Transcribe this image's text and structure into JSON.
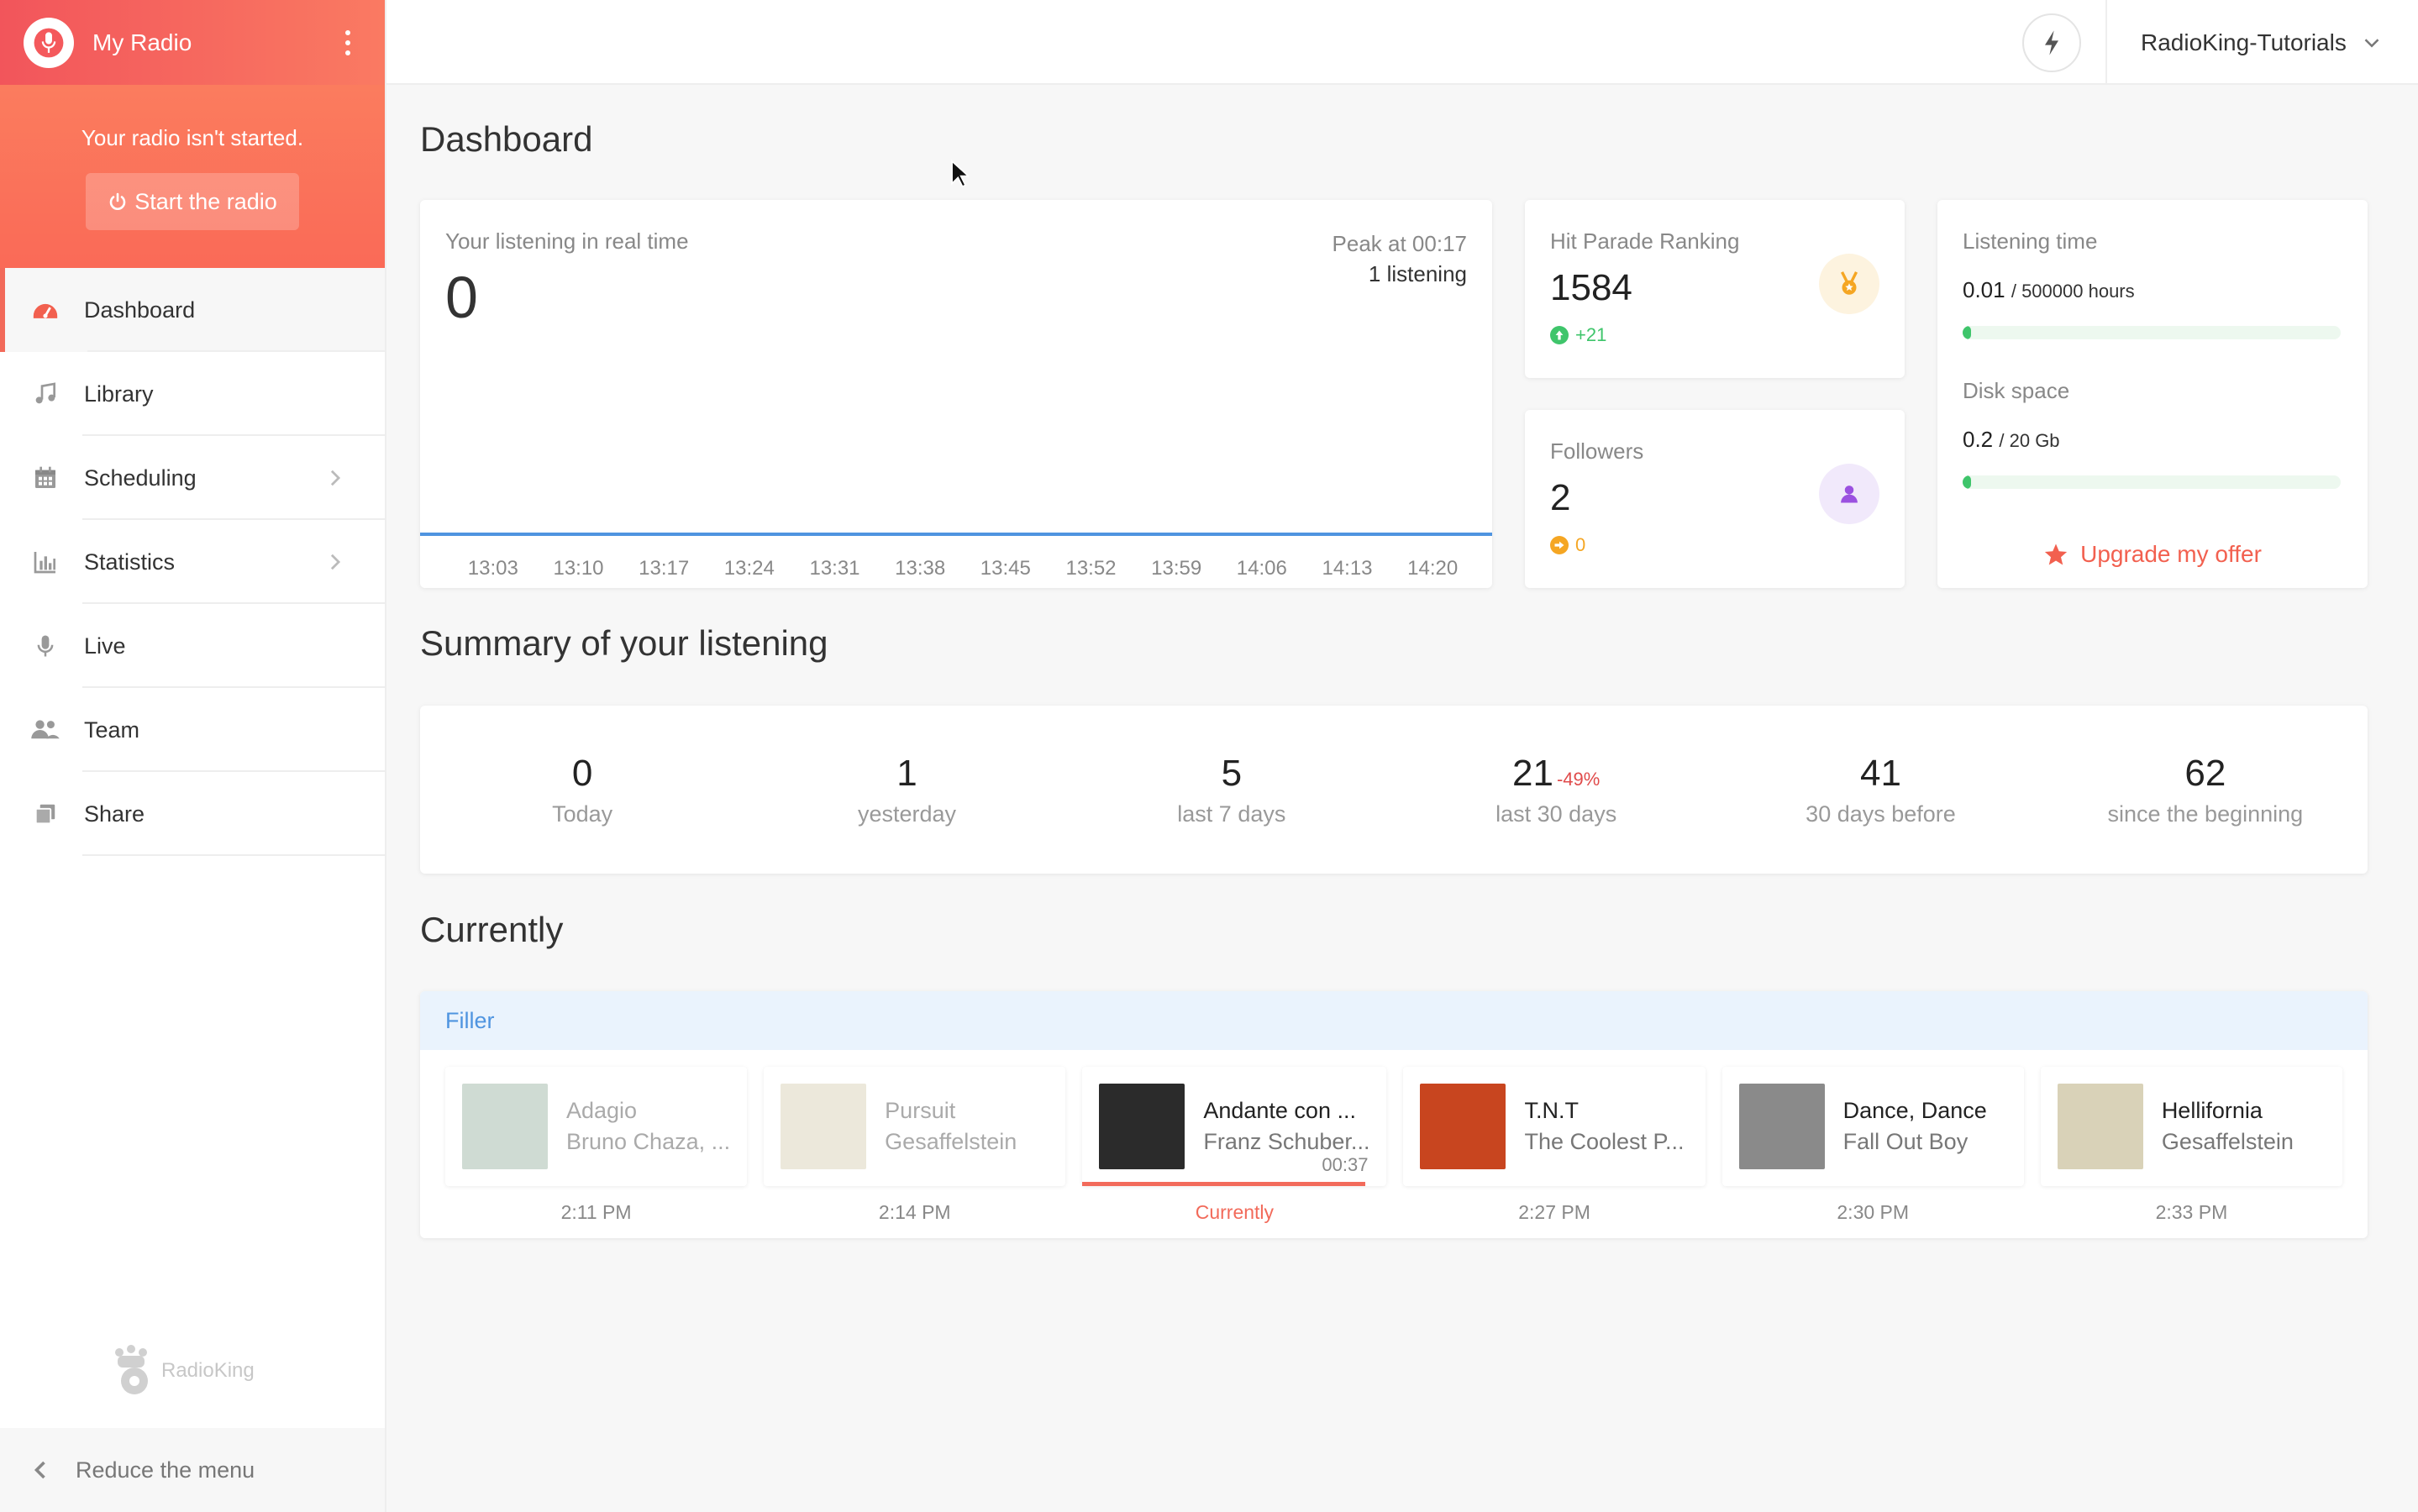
{
  "sidebar": {
    "radio_name": "My Radio",
    "status_text": "Your radio isn't started.",
    "start_label": "Start the radio",
    "items": [
      {
        "label": "Dashboard",
        "icon": "dashboard-icon",
        "active": true
      },
      {
        "label": "Library",
        "icon": "music-note-icon"
      },
      {
        "label": "Scheduling",
        "icon": "calendar-icon",
        "chevron": true
      },
      {
        "label": "Statistics",
        "icon": "bar-chart-icon",
        "chevron": true
      },
      {
        "label": "Live",
        "icon": "microphone-icon"
      },
      {
        "label": "Team",
        "icon": "users-icon"
      },
      {
        "label": "Share",
        "icon": "share-icon"
      }
    ],
    "logo_text": "RadioKing",
    "reduce_label": "Reduce the menu"
  },
  "topbar": {
    "account_name": "RadioKing-Tutorials"
  },
  "page": {
    "title": "Dashboard"
  },
  "realtime": {
    "label": "Your listening in real time",
    "value": "0",
    "peak_label": "Peak at 00:17",
    "peak_listening": "1 listening"
  },
  "chart_data": {
    "type": "line",
    "x": [
      "13:03",
      "13:10",
      "13:17",
      "13:24",
      "13:31",
      "13:38",
      "13:45",
      "13:52",
      "13:59",
      "14:06",
      "14:13",
      "14:20"
    ],
    "series": [
      {
        "values": [
          0,
          0,
          0,
          0,
          0,
          0,
          0,
          0,
          0,
          0,
          0,
          0
        ]
      }
    ],
    "title": "",
    "xlabel": "",
    "ylabel": "",
    "grid": false
  },
  "hit_parade": {
    "label": "Hit Parade Ranking",
    "value": "1584",
    "delta": "+21",
    "delta_color": "#3fc56b"
  },
  "followers": {
    "label": "Followers",
    "value": "2",
    "delta": "0",
    "delta_color": "#f5a623"
  },
  "usage": {
    "listening_label": "Listening time",
    "listening_value": "0.01",
    "listening_total": "/ 500000 hours",
    "listening_fraction": 2e-08,
    "disk_label": "Disk space",
    "disk_value": "0.2",
    "disk_total": "/ 20 Gb",
    "disk_fraction": 0.01,
    "upgrade_label": "Upgrade my offer"
  },
  "summary": {
    "title": "Summary of your listening",
    "cells": [
      {
        "value": "0",
        "label": "Today",
        "pct": ""
      },
      {
        "value": "1",
        "label": "yesterday",
        "pct": ""
      },
      {
        "value": "5",
        "label": "last 7 days",
        "pct": ""
      },
      {
        "value": "21",
        "label": "last 30 days",
        "pct": "-49%"
      },
      {
        "value": "41",
        "label": "30 days before",
        "pct": ""
      },
      {
        "value": "62",
        "label": "since the beginning",
        "pct": ""
      }
    ]
  },
  "currently": {
    "title": "Currently",
    "playlist": "Filler",
    "tracks": [
      {
        "title": "Adagio",
        "artist": "Bruno Chaza, ...",
        "time": "2:11 PM",
        "state": "past",
        "cover": "#9fb7a8"
      },
      {
        "title": "Pursuit",
        "artist": "Gesaffelstein",
        "time": "2:14 PM",
        "state": "past",
        "cover": "#d9d2b8"
      },
      {
        "title": "Andante con ...",
        "artist": "Franz Schuber...",
        "time": "Currently",
        "elapsed": "00:37",
        "progress": 0.93,
        "state": "current",
        "cover": "#2b2b2b"
      },
      {
        "title": "T.N.T",
        "artist": "The Coolest P...",
        "time": "2:27 PM",
        "state": "upcoming",
        "cover": "#c8451f"
      },
      {
        "title": "Dance, Dance",
        "artist": "Fall Out Boy",
        "time": "2:30 PM",
        "state": "upcoming",
        "cover": "#8a8a8a"
      },
      {
        "title": "Hellifornia",
        "artist": "Gesaffelstein",
        "time": "2:33 PM",
        "state": "upcoming",
        "cover": "#d9d2b8"
      }
    ]
  }
}
